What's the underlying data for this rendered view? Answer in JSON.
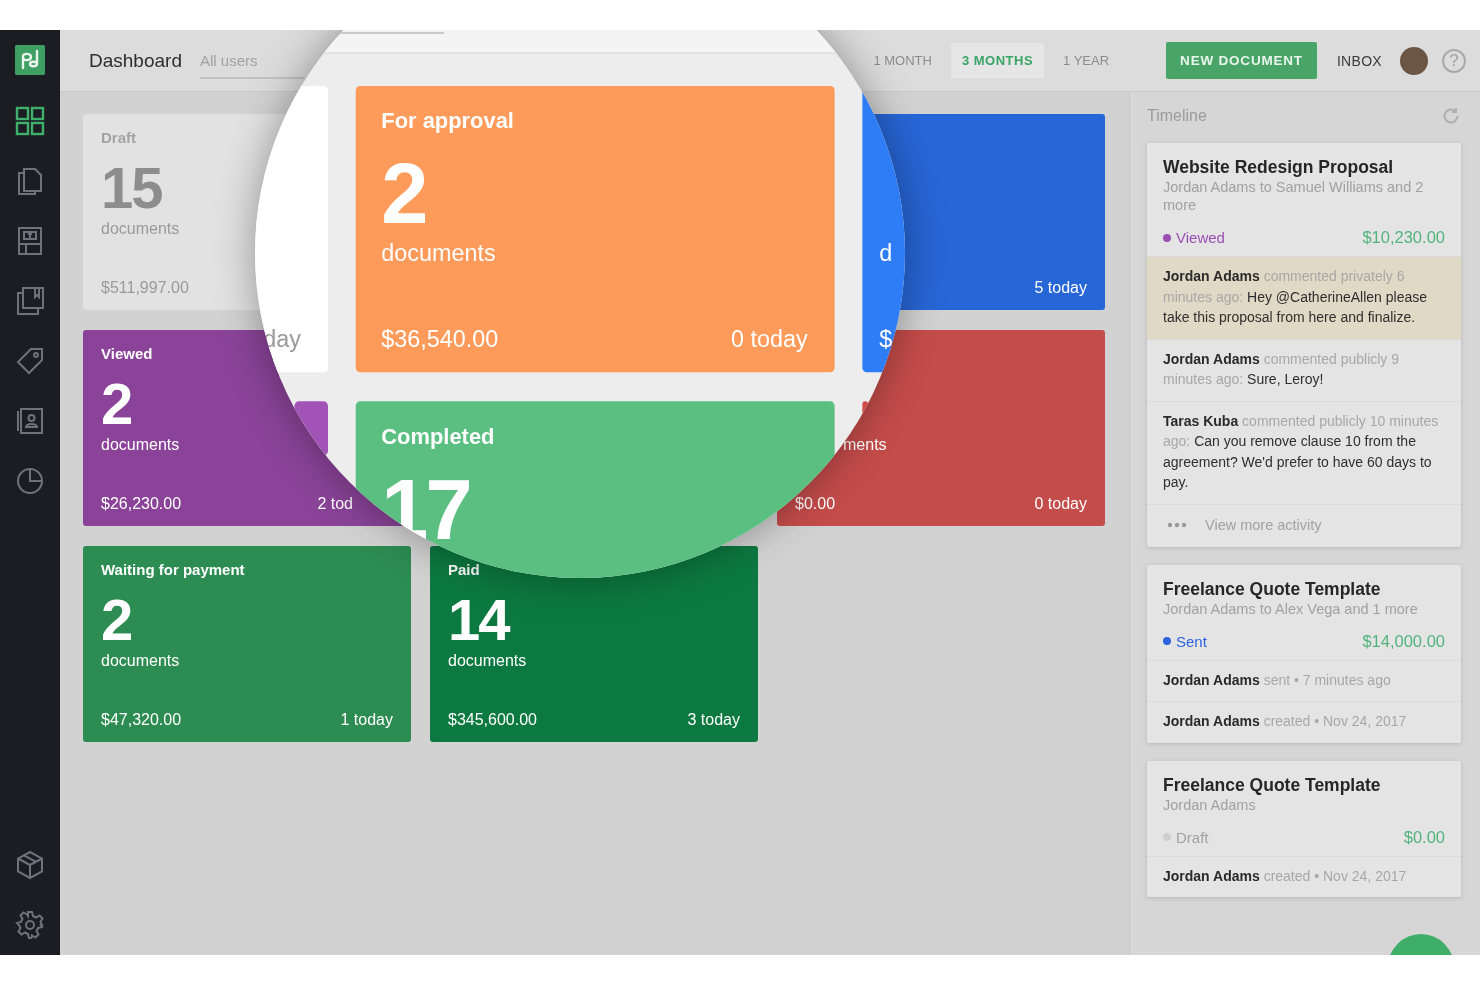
{
  "sidebar": {
    "nav": [
      {
        "kind": "grid",
        "selected": true
      },
      {
        "kind": "documents",
        "selected": false
      },
      {
        "kind": "templates",
        "selected": false
      },
      {
        "kind": "library",
        "selected": false
      },
      {
        "kind": "tag",
        "selected": false
      },
      {
        "kind": "contacts",
        "selected": false
      },
      {
        "kind": "chart",
        "selected": false
      }
    ],
    "bottom_nav": [
      {
        "kind": "cube",
        "selected": false
      },
      {
        "kind": "settings",
        "selected": false
      }
    ]
  },
  "header": {
    "title": "Dashboard",
    "filter": {
      "placeholder": "All users"
    },
    "ranges": [
      {
        "label": "1 MONTH",
        "selected": false
      },
      {
        "label": "3 MONTHS",
        "selected": true
      },
      {
        "label": "1 YEAR",
        "selected": false
      }
    ],
    "new_button": "NEW DOCUMENT",
    "inbox": "INBOX",
    "help": "?"
  },
  "cards": [
    {
      "title": "Draft",
      "count": "15",
      "unit": "documents",
      "amount": "$511,997.00",
      "color": "#e2e2e2"
    },
    {
      "reading": "5 today",
      "color": "#2766d6"
    },
    {
      "title": "Viewed",
      "count": "2",
      "unit": "documents",
      "amount": "$26,230.00",
      "reading": "2 tod",
      "color": "#8a4398"
    },
    {
      "unit": "ments",
      "amount": "$0.00",
      "reading": "0 today",
      "color": "#c44c4a"
    },
    {
      "title": "Waiting for payment",
      "count": "2",
      "unit": "documents",
      "amount": "$47,320.00",
      "reading": "1 today",
      "color": "#2d8c52"
    },
    {
      "title": "Paid",
      "count": "14",
      "unit": "documents",
      "amount": "$345,600.00",
      "reading": "3 today",
      "color": "#0c7a40"
    }
  ],
  "magnifier": {
    "cards": [
      {
        "reading": "day",
        "color": "#ffffff"
      },
      {
        "title": "For approval",
        "count": "2",
        "unit": "documents",
        "amount": "$36,540.00",
        "reading": "0 today",
        "color": "#fe9b5a"
      },
      {
        "unit": "d",
        "amount": "$",
        "color": "#2e7cf6"
      },
      {
        "color": "#a154b5"
      },
      {
        "title": "Completed",
        "count": "17",
        "color": "#5bbf81"
      },
      {
        "color": "#cf4b48"
      }
    ]
  },
  "timeline": {
    "title": "Timeline",
    "cards": [
      {
        "title": "Website Redesign Proposal",
        "recipients": "Jordan Adams to Samuel Williams and 2 more",
        "status": {
          "label": "Viewed",
          "color": "#9b4fb3"
        },
        "amount": "$10,230.00",
        "activities": [
          {
            "author": "Jordan Adams",
            "action": "commented privately 6 minutes ago:",
            "message": "Hey @CatherineAllen please take this proposal from here and finalize.",
            "highlighted": true
          },
          {
            "author": "Jordan Adams",
            "action": "commented publicly 9 minutes ago:",
            "message": "Sure, Leroy!",
            "highlighted": false
          },
          {
            "author": "Taras Kuba",
            "action": "commented publicly 10 minutes ago:",
            "message": "Can you remove clause 10 from the agreement? We'd prefer to have 60 days to pay.",
            "highlighted": false
          }
        ],
        "more": "View more activity"
      },
      {
        "title": "Freelance Quote Template",
        "recipients": "Jordan Adams to Alex Vega and 1 more",
        "status": {
          "label": "Sent",
          "color": "#2b63e0"
        },
        "amount": "$14,000.00",
        "activities": [
          {
            "author": "Jordan Adams",
            "action": "sent • 7 minutes ago",
            "highlighted": false
          },
          {
            "author": "Jordan Adams",
            "action": "created • Nov 24, 2017",
            "highlighted": false
          }
        ]
      },
      {
        "title": "Freelance Quote Template",
        "recipients": "Jordan Adams",
        "status": {
          "label": "Draft",
          "color": "#cfcfcf"
        },
        "amount": "$0.00",
        "activities": [
          {
            "author": "Jordan Adams",
            "action": "created • Nov 24, 2017",
            "highlighted": false
          }
        ]
      }
    ]
  }
}
